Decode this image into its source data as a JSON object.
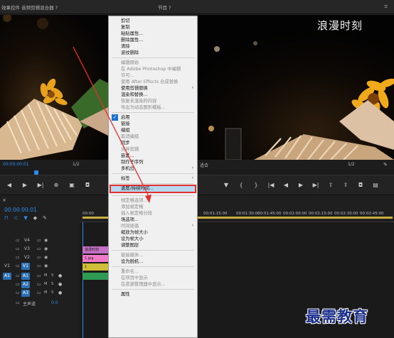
{
  "source_monitor": {
    "title": "效果控件  音频剪辑混合器 ?"
  },
  "program_monitor": {
    "title": "节目 ?",
    "menu_glyph": "≡"
  },
  "left_controls": {
    "fraction": "1/2",
    "timecode_display": "00:00:00:01"
  },
  "right_controls": {
    "fit_label": "适合",
    "fraction": "1/2"
  },
  "timeline": {
    "tab_close": "×",
    "timecode": "00:00:00:01",
    "ruler_labels": [
      "00:00",
      "00:01:15:00",
      "00:01:30:00",
      "00:01:45:00",
      "00:02:00:00",
      "00:02:15:00",
      "00:02:30:00",
      "00:02:45:00"
    ],
    "tracks": [
      {
        "name": "V4"
      },
      {
        "name": "V3"
      },
      {
        "name": "V2"
      },
      {
        "name": "V1",
        "left_tag": "V1"
      },
      {
        "name": "A1",
        "left_tag": "A1"
      },
      {
        "name": "A2"
      },
      {
        "name": "A3"
      }
    ],
    "master": {
      "label": "主声道",
      "value": "0.0"
    },
    "clips": {
      "v3": "浪漫时刻",
      "v2": "1.jpg",
      "v1": "1"
    }
  },
  "context_menu": {
    "items": [
      {
        "label": "剪切",
        "disabled": false
      },
      {
        "label": "复制",
        "disabled": false
      },
      {
        "label": "粘贴属性...",
        "disabled": false
      },
      {
        "label": "删除属性...",
        "disabled": false
      },
      {
        "label": "清除",
        "disabled": false
      },
      {
        "label": "波纹删除",
        "disabled": false
      },
      {
        "sep": true
      },
      {
        "label": "编辑原始",
        "disabled": true
      },
      {
        "label": "在 Adobe Photoshop 中编辑",
        "disabled": true
      },
      {
        "label": "许可...",
        "disabled": true
      },
      {
        "label": "使用 After Effects 合成替换",
        "disabled": true
      },
      {
        "label": "使用剪辑替换",
        "disabled": false,
        "submenu": true
      },
      {
        "label": "渲染和替换...",
        "disabled": false
      },
      {
        "label": "恢复未渲染的内容",
        "disabled": true
      },
      {
        "label": "导出为动态图形模板...",
        "disabled": true
      },
      {
        "sep": true
      },
      {
        "label": "启用",
        "disabled": false,
        "checked": true
      },
      {
        "label": "链接",
        "disabled": false
      },
      {
        "label": "编组",
        "disabled": false
      },
      {
        "label": "取消编组",
        "disabled": true
      },
      {
        "label": "同步",
        "disabled": false
      },
      {
        "label": "合并剪辑",
        "disabled": true
      },
      {
        "label": "嵌套...",
        "disabled": false
      },
      {
        "label": "制作子序列",
        "disabled": false
      },
      {
        "label": "多机位",
        "disabled": false,
        "submenu": true
      },
      {
        "sep": true
      },
      {
        "label": "标签",
        "disabled": false,
        "submenu": true
      },
      {
        "sep": true
      },
      {
        "label": "速度/持续时间...",
        "disabled": false,
        "highlight": true
      },
      {
        "sep": true
      },
      {
        "label": "帧定格选项...",
        "disabled": true
      },
      {
        "label": "添加帧定格",
        "disabled": true
      },
      {
        "label": "插入帧定格分段",
        "disabled": true
      },
      {
        "label": "场选项...",
        "disabled": false
      },
      {
        "label": "时间插值",
        "disabled": true,
        "submenu": true
      },
      {
        "label": "缩放为帧大小",
        "disabled": false
      },
      {
        "label": "设为帧大小",
        "disabled": false
      },
      {
        "label": "调整图层",
        "disabled": false
      },
      {
        "sep": true
      },
      {
        "label": "链接媒体...",
        "disabled": true
      },
      {
        "label": "设为脱机...",
        "disabled": false
      },
      {
        "sep": true
      },
      {
        "label": "重命名...",
        "disabled": true
      },
      {
        "label": "在项目中显示",
        "disabled": true
      },
      {
        "label": "在资源管理器中显示...",
        "disabled": true
      },
      {
        "sep": true
      },
      {
        "label": "属性",
        "disabled": false
      }
    ]
  },
  "watermarks": {
    "top": "浪漫时刻",
    "bottom": "最需教育"
  },
  "colors": {
    "accent": "#2d8ceb",
    "highlight_border": "#e03030",
    "clip_purple": "#c76fc8",
    "clip_pink": "#f07ac7",
    "clip_green": "#2f9a53",
    "clip_yellow": "#cfbf38",
    "arrow": "#e03030"
  }
}
